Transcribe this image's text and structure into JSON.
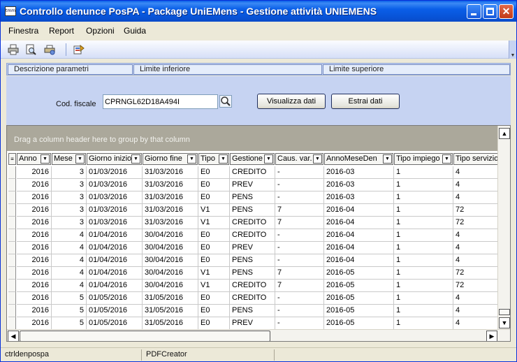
{
  "window": {
    "title": "Controllo denunce PosPA - Package UniEMens - Gestione attività UNIEMENS",
    "icon_text": "tmm"
  },
  "menu": [
    "Finestra",
    "Report",
    "Opzioni",
    "Guida"
  ],
  "toolbar": {
    "icons": [
      "print-icon",
      "print-preview-icon",
      "print-setup-icon",
      "export-icon"
    ]
  },
  "params_header": {
    "col1": "Descrizione parametri",
    "col2": "Limite inferiore",
    "col3": "Limite superiore"
  },
  "params": {
    "cf_label": "Cod. fiscale",
    "cf_value": "CPRNGL62D18A494I",
    "view_button": "Visualizza dati",
    "extract_button": "Estrai dati"
  },
  "grid": {
    "group_hint": "Drag a column header here to group by that column",
    "columns": [
      "Anno",
      "Mese",
      "Giorno inizio",
      "Giorno fine",
      "Tipo",
      "Gestione",
      "Caus. var.",
      "AnnoMeseDen",
      "Tipo impiego",
      "Tipo servizio"
    ],
    "rows": [
      [
        "2016",
        "3",
        "01/03/2016",
        "31/03/2016",
        "E0",
        "CREDITO",
        "-",
        "2016-03",
        "1",
        "4"
      ],
      [
        "2016",
        "3",
        "01/03/2016",
        "31/03/2016",
        "E0",
        "PREV",
        "-",
        "2016-03",
        "1",
        "4"
      ],
      [
        "2016",
        "3",
        "01/03/2016",
        "31/03/2016",
        "E0",
        "PENS",
        "-",
        "2016-03",
        "1",
        "4"
      ],
      [
        "2016",
        "3",
        "01/03/2016",
        "31/03/2016",
        "V1",
        "PENS",
        "7",
        "2016-04",
        "1",
        "72"
      ],
      [
        "2016",
        "3",
        "01/03/2016",
        "31/03/2016",
        "V1",
        "CREDITO",
        "7",
        "2016-04",
        "1",
        "72"
      ],
      [
        "2016",
        "4",
        "01/04/2016",
        "30/04/2016",
        "E0",
        "CREDITO",
        "-",
        "2016-04",
        "1",
        "4"
      ],
      [
        "2016",
        "4",
        "01/04/2016",
        "30/04/2016",
        "E0",
        "PREV",
        "-",
        "2016-04",
        "1",
        "4"
      ],
      [
        "2016",
        "4",
        "01/04/2016",
        "30/04/2016",
        "E0",
        "PENS",
        "-",
        "2016-04",
        "1",
        "4"
      ],
      [
        "2016",
        "4",
        "01/04/2016",
        "30/04/2016",
        "V1",
        "PENS",
        "7",
        "2016-05",
        "1",
        "72"
      ],
      [
        "2016",
        "4",
        "01/04/2016",
        "30/04/2016",
        "V1",
        "CREDITO",
        "7",
        "2016-05",
        "1",
        "72"
      ],
      [
        "2016",
        "5",
        "01/05/2016",
        "31/05/2016",
        "E0",
        "CREDITO",
        "-",
        "2016-05",
        "1",
        "4"
      ],
      [
        "2016",
        "5",
        "01/05/2016",
        "31/05/2016",
        "E0",
        "PENS",
        "-",
        "2016-05",
        "1",
        "4"
      ],
      [
        "2016",
        "5",
        "01/05/2016",
        "31/05/2016",
        "E0",
        "PREV",
        "-",
        "2016-05",
        "1",
        "4"
      ]
    ]
  },
  "status": {
    "pane1": "ctrldenpospa",
    "pane2": "PDFCreator"
  }
}
